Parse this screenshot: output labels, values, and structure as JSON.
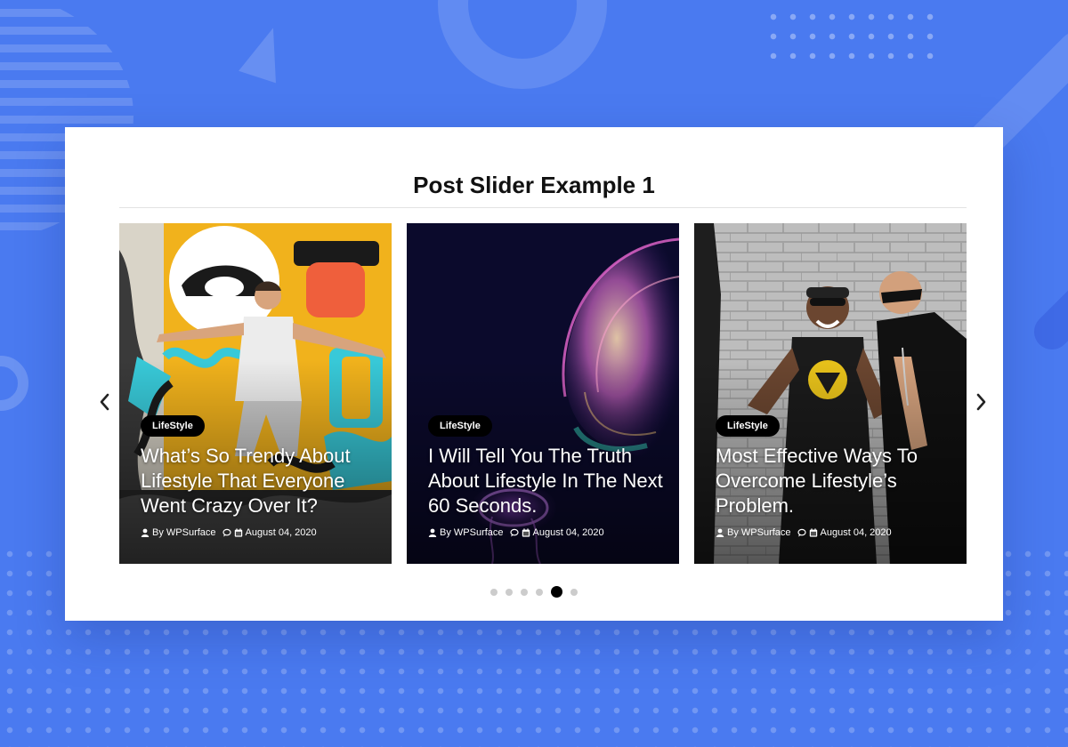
{
  "page": {
    "title": "Post Slider Example 1",
    "background_color": "#4a7af0"
  },
  "slider": {
    "prev_icon": "chevron-left-icon",
    "next_icon": "chevron-right-icon",
    "active_dot_index": 4,
    "dot_count": 6,
    "slides": [
      {
        "category": "LifeStyle",
        "title": "What’s So Trendy About Lifestyle That Everyone Went Crazy Over It?",
        "author": "By WPSurface",
        "date": "August 04, 2020"
      },
      {
        "category": "LifeStyle",
        "title": "I Will Tell You The Truth About Lifestyle In The Next 60 Seconds.",
        "author": "By WPSurface",
        "date": "August 04, 2020"
      },
      {
        "category": "LifeStyle",
        "title": "Most Effective Ways To Overcome Lifestyle’s Problem.",
        "author": "By WPSurface",
        "date": "August 04, 2020"
      }
    ]
  },
  "colors": {
    "badge_bg": "#000000",
    "dot_active": "#000000",
    "dot_inactive": "#cccccc"
  }
}
